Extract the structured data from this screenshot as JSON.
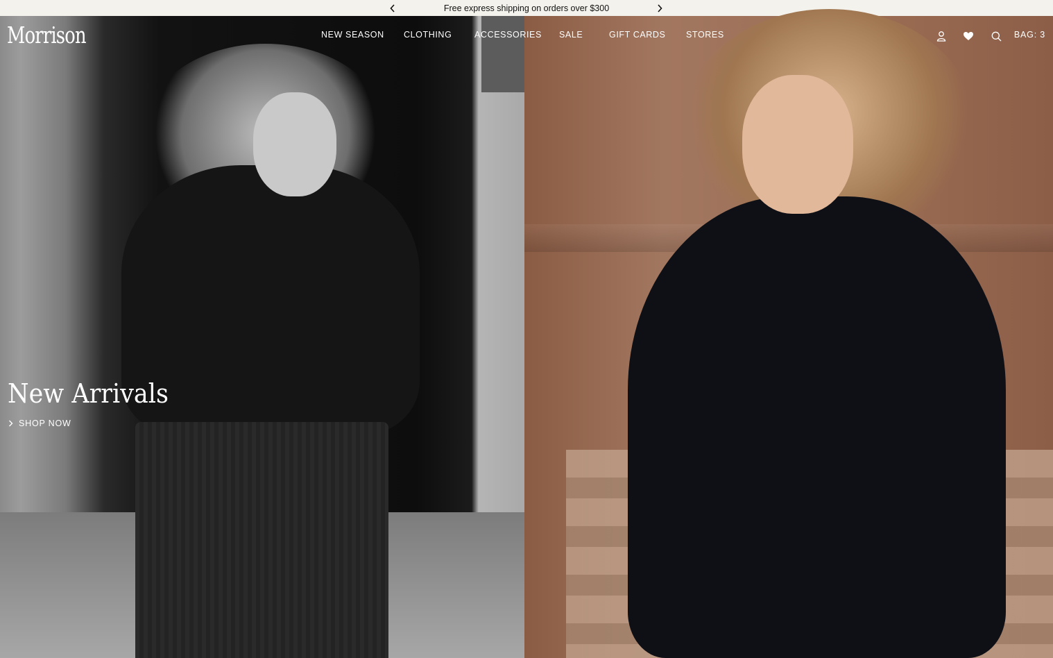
{
  "announcement": {
    "text": "Free express shipping on orders over $300",
    "prev_icon": "chevron-left-icon",
    "next_icon": "chevron-right-icon"
  },
  "header": {
    "logo": "Morrison",
    "nav": [
      {
        "label": "NEW SEASON"
      },
      {
        "label": "CLOTHING"
      },
      {
        "label": "ACCESSORIES"
      },
      {
        "label": "SALE"
      },
      {
        "label": "GIFT CARDS"
      },
      {
        "label": "STORES"
      }
    ],
    "icons": [
      "user-icon",
      "heart-icon",
      "search-icon"
    ],
    "bag_label": "BAG: 3"
  },
  "hero": {
    "title": "New Arrivals",
    "cta": "SHOP NOW"
  },
  "colors": {
    "announcement_bg": "#f3f2ec",
    "text_light": "#ffffff",
    "text_dark": "#111111"
  }
}
